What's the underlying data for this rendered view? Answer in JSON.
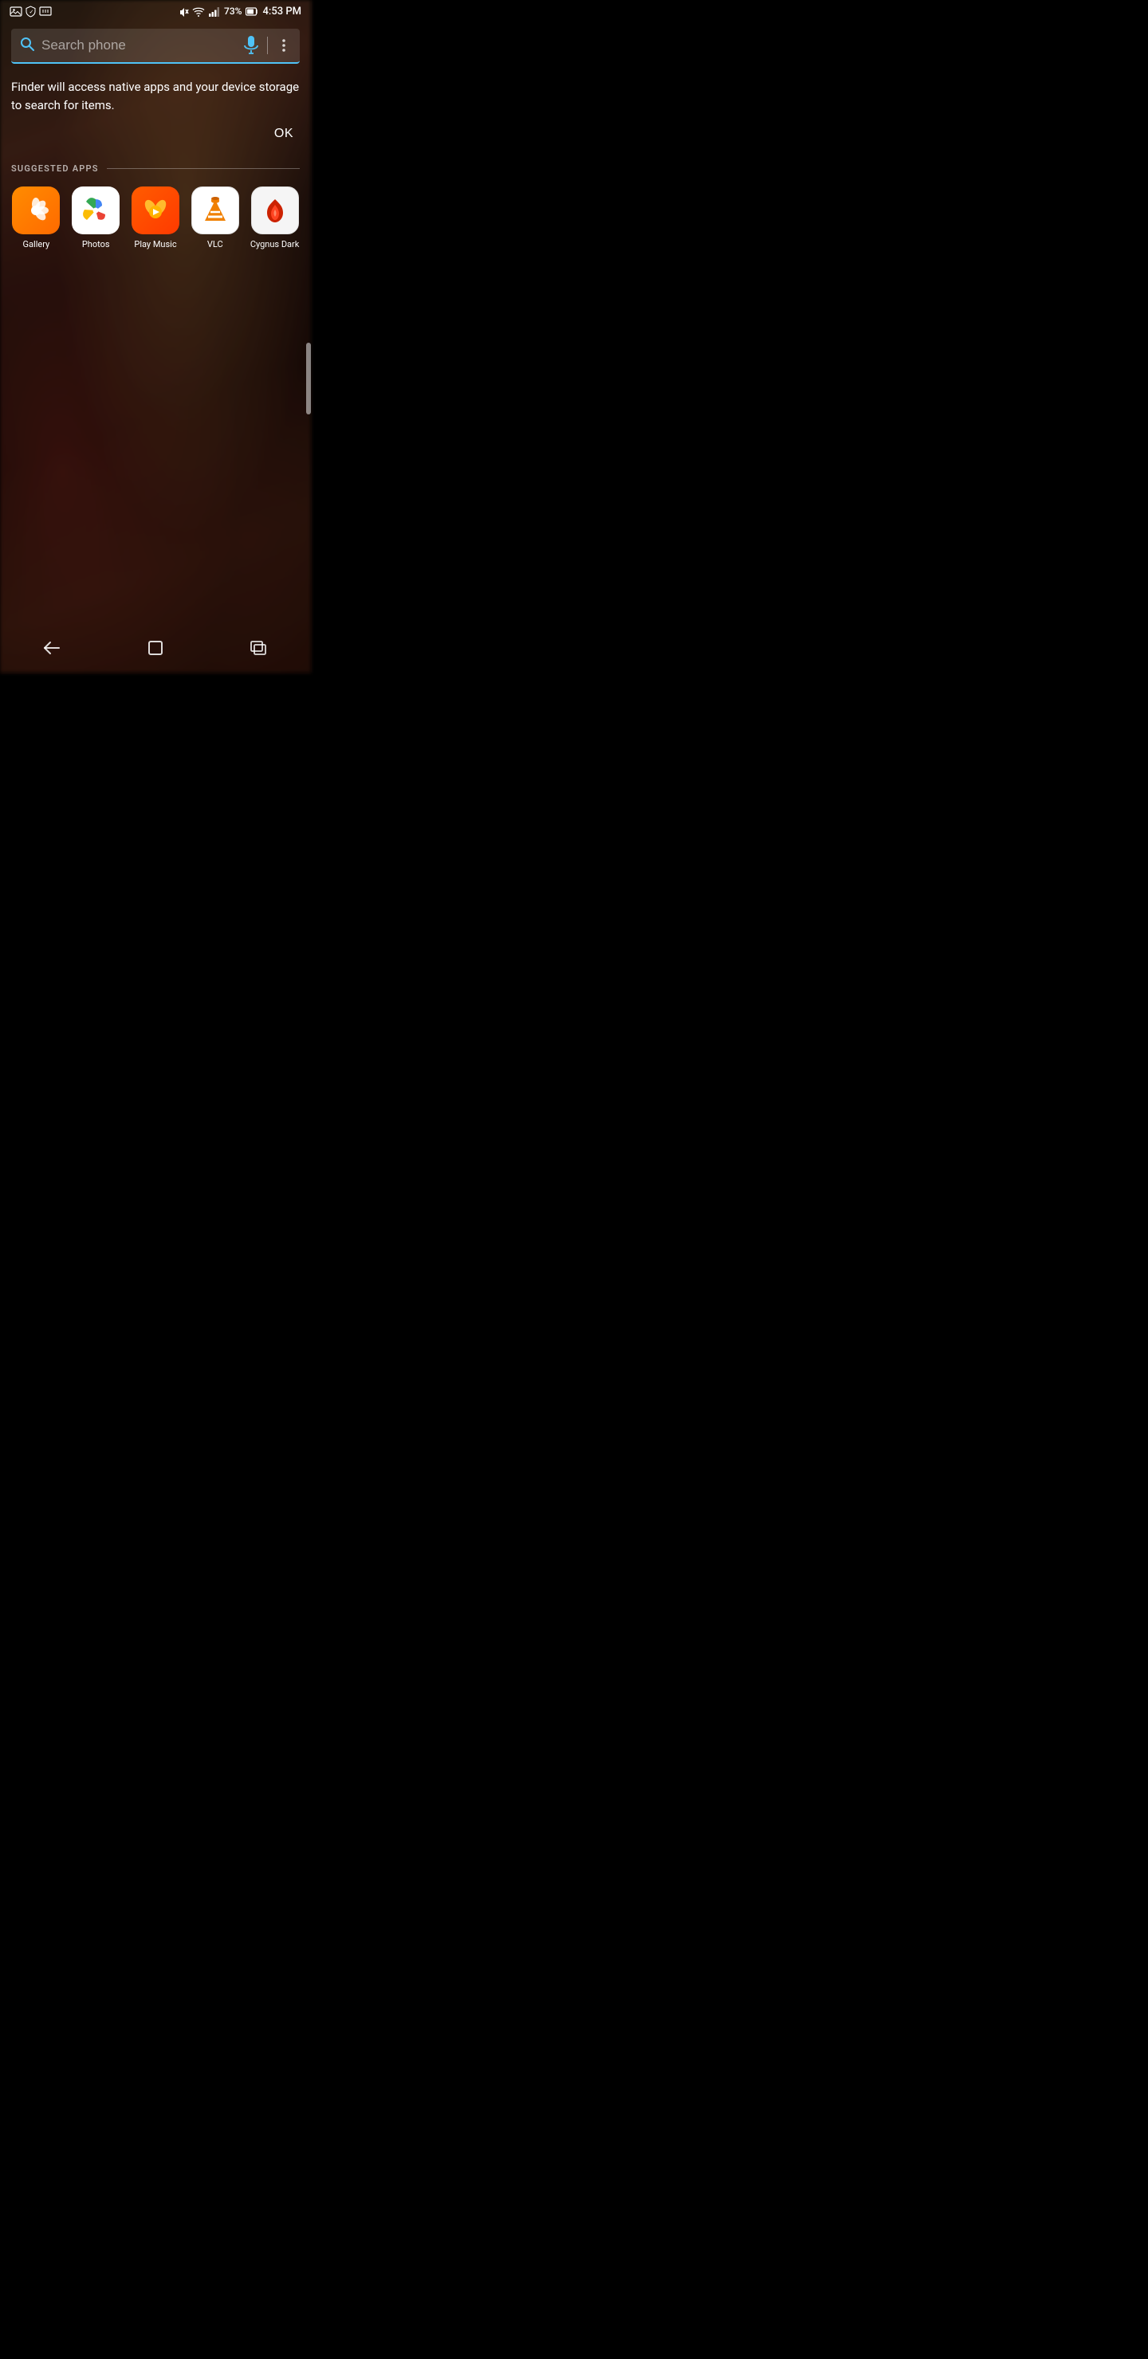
{
  "statusBar": {
    "time": "4:53 PM",
    "battery": "73%",
    "signal": "73%"
  },
  "search": {
    "placeholder": "Search phone"
  },
  "notice": {
    "text": "Finder will access native apps and your device storage to search for items.",
    "ok_label": "OK"
  },
  "suggestedApps": {
    "section_label": "SUGGESTED APPS",
    "apps": [
      {
        "id": "gallery",
        "name": "Gallery"
      },
      {
        "id": "photos",
        "name": "Photos"
      },
      {
        "id": "playmusic",
        "name": "Play Music"
      },
      {
        "id": "vlc",
        "name": "VLC"
      },
      {
        "id": "cygnus",
        "name": "Cygnus Dark"
      }
    ]
  },
  "nav": {
    "back_label": "←",
    "home_label": "□",
    "recent_label": "⇥"
  }
}
